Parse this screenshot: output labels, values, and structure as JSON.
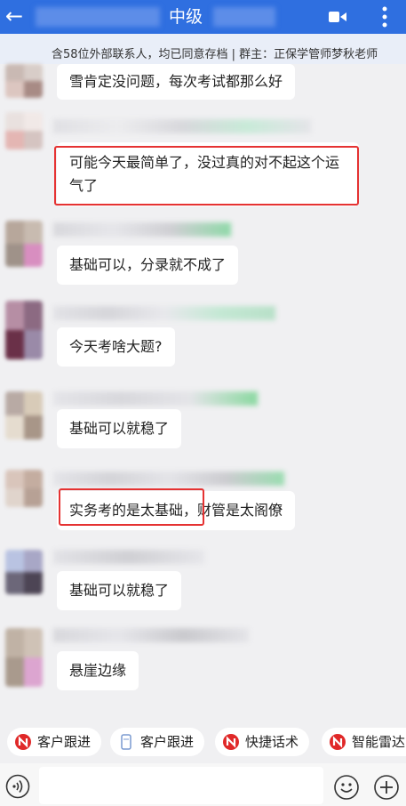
{
  "header": {
    "back_icon": "back-arrow-icon",
    "title": "中级",
    "video_icon": "video-call-icon",
    "more_icon": "more-vert-icon"
  },
  "notice": "含58位外部联系人，均已同意存档 | 群主：正保学管师梦秋老师",
  "messages": [
    {
      "text": "雪肯定没问题，每次考试都那么好"
    },
    {
      "text": "可能今天最简单了，没过真的对不起这个运气了",
      "highlighted": true
    },
    {
      "text": "基础可以，分录就不成了"
    },
    {
      "text": "今天考啥大题?"
    },
    {
      "text": "基础可以就稳了"
    },
    {
      "text": "实务考的是太基础，财管是太阁僚",
      "highlighted_part": "实务考的是太基础"
    },
    {
      "text": "基础可以就稳了"
    },
    {
      "text": "悬崖边缘"
    }
  ],
  "quick_actions": [
    {
      "label": "客户跟进",
      "icon": "red-n-icon"
    },
    {
      "label": "客户跟进",
      "icon": "document-icon"
    },
    {
      "label": "快捷话术",
      "icon": "red-n-icon"
    },
    {
      "label": "智能雷达",
      "icon": "red-n-icon"
    }
  ],
  "input": {
    "placeholder": ""
  },
  "colors": {
    "header": "#2f6fe0",
    "highlight": "#e53232",
    "bubble": "#ffffff"
  }
}
